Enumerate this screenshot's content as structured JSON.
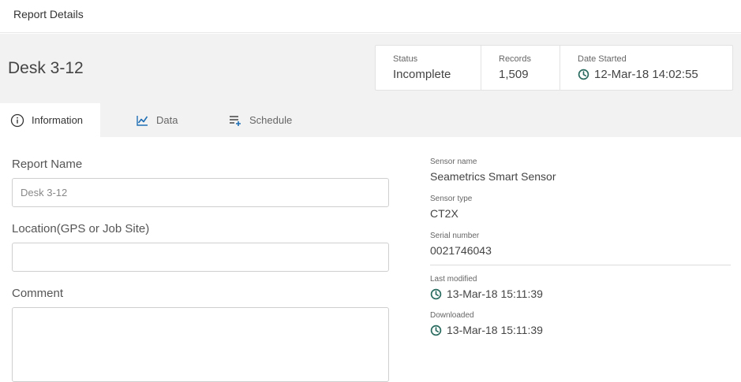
{
  "page": {
    "title": "Report Details"
  },
  "header": {
    "device_name": "Desk 3-12",
    "stats": [
      {
        "label": "Status",
        "value": "Incomplete"
      },
      {
        "label": "Records",
        "value": "1,509"
      },
      {
        "label": "Date Started",
        "value": "12-Mar-18 14:02:55",
        "icon": "clock-icon"
      }
    ]
  },
  "tabs": [
    {
      "label": "Information",
      "icon": "info-icon",
      "active": true
    },
    {
      "label": "Data",
      "icon": "chart-icon",
      "active": false
    },
    {
      "label": "Schedule",
      "icon": "schedule-list-icon",
      "active": false
    }
  ],
  "form": {
    "report_name_label": "Report Name",
    "report_name_placeholder": "Desk 3-12",
    "location_label": "Location(GPS or Job Site)",
    "location_value": "",
    "comment_label": "Comment",
    "comment_value": ""
  },
  "details": {
    "sensor_name_label": "Sensor name",
    "sensor_name": "Seametrics Smart Sensor",
    "sensor_type_label": "Sensor type",
    "sensor_type": "CT2X",
    "serial_number_label": "Serial number",
    "serial_number": "0021746043",
    "last_modified_label": "Last modified",
    "last_modified": "13-Mar-18 15:11:39",
    "downloaded_label": "Downloaded",
    "downloaded": "13-Mar-18 15:11:39"
  },
  "colors": {
    "accent_teal": "#2a6b5f",
    "icon_blue": "#1f6fb5",
    "panel_gray": "#f2f2f2"
  }
}
